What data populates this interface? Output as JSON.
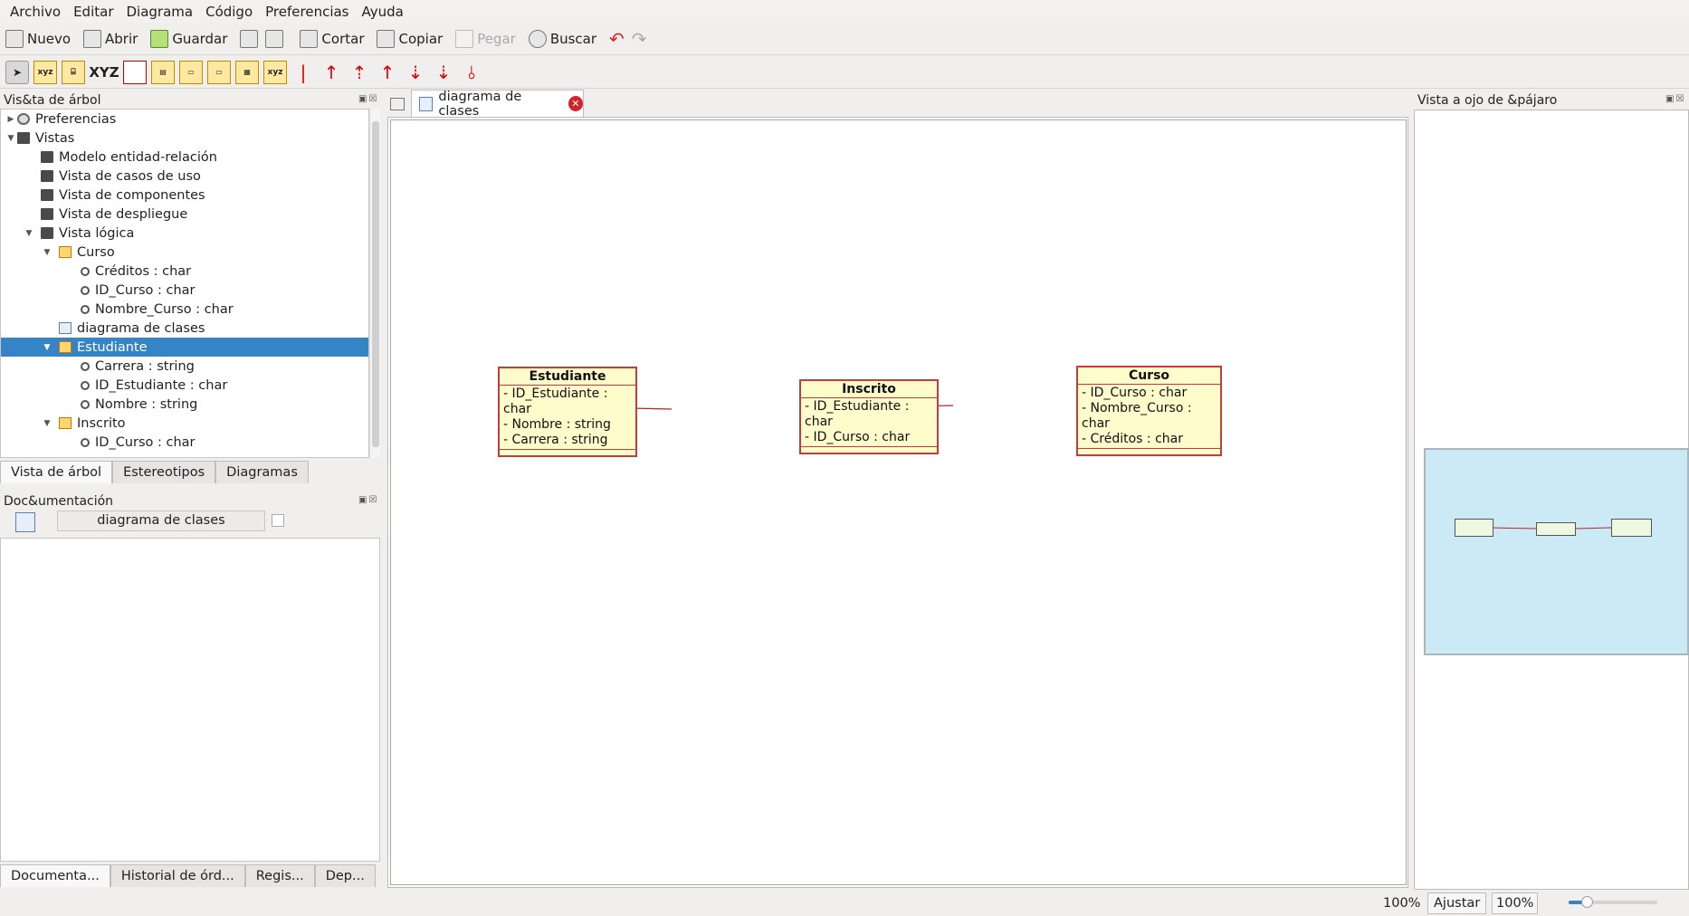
{
  "menu": [
    "Archivo",
    "Editar",
    "Diagrama",
    "Código",
    "Preferencias",
    "Ayuda"
  ],
  "toolbar": {
    "new": "Nuevo",
    "open": "Abrir",
    "save": "Guardar",
    "cut": "Cortar",
    "copy": "Copiar",
    "paste": "Pegar",
    "search": "Buscar"
  },
  "tool_labels": {
    "xyz": "XYZ"
  },
  "tree_panel": {
    "title": "Vis&ta de árbol",
    "items": [
      {
        "label": "Preferencias"
      },
      {
        "label": "Vistas"
      },
      {
        "label": "Modelo entidad-relación"
      },
      {
        "label": "Vista de casos de uso"
      },
      {
        "label": "Vista de componentes"
      },
      {
        "label": "Vista de despliegue"
      },
      {
        "label": "Vista lógica"
      },
      {
        "label": "Curso"
      },
      {
        "label": "Créditos : char"
      },
      {
        "label": "ID_Curso : char"
      },
      {
        "label": "Nombre_Curso : char"
      },
      {
        "label": "diagrama de clases"
      },
      {
        "label": "Estudiante"
      },
      {
        "label": "Carrera : string"
      },
      {
        "label": "ID_Estudiante : char"
      },
      {
        "label": "Nombre : string"
      },
      {
        "label": "Inscrito"
      },
      {
        "label": "ID_Curso : char"
      }
    ],
    "tabs": [
      "Vista de árbol",
      "Estereotipos",
      "Diagramas"
    ]
  },
  "doc_panel": {
    "title": "Doc&umentación",
    "diagram_name": "diagrama de clases",
    "tabs": [
      "Documenta...",
      "Historial de órd...",
      "Regis...",
      "Dep..."
    ]
  },
  "editor_tab": {
    "label": "diagrama de clases"
  },
  "classes": {
    "estudiante": {
      "name": "Estudiante",
      "attrs": [
        "- ID_Estudiante : char",
        "- Nombre : string",
        "- Carrera : string"
      ]
    },
    "inscrito": {
      "name": "Inscrito",
      "attrs": [
        "- ID_Estudiante : char",
        "- ID_Curso : char"
      ]
    },
    "curso": {
      "name": "Curso",
      "attrs": [
        "- ID_Curso : char",
        "- Nombre_Curso : char",
        "- Créditos : char"
      ]
    }
  },
  "bird_panel": {
    "title": "Vista a ojo de &pájaro"
  },
  "status": {
    "zoom_left": "100%",
    "fit": "Ajustar",
    "zoom_right": "100%"
  }
}
